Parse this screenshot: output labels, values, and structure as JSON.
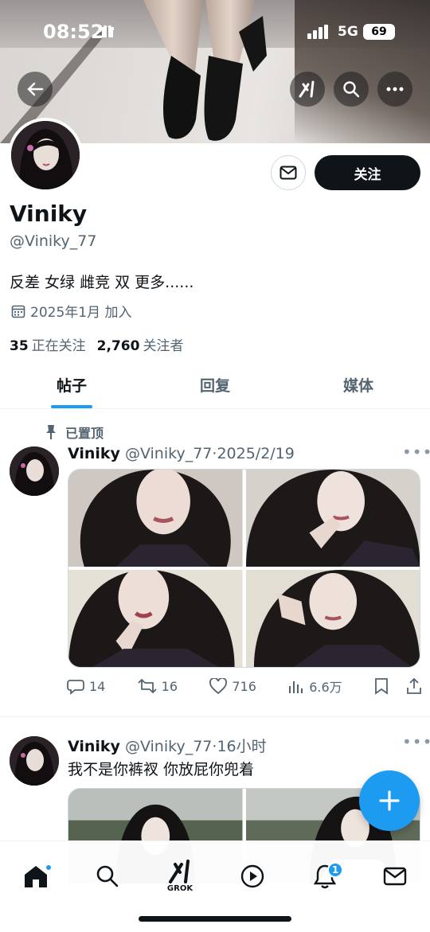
{
  "status_bar": {
    "time": "08:52",
    "network": "5G",
    "battery": "69"
  },
  "profile": {
    "name": "Viniky",
    "handle": "@Viniky_77",
    "bio": "反差 女绿 雌竞 双 更多......",
    "joined": "2025年1月 加入",
    "following_count": "35",
    "following_label": "正在关注",
    "followers_count": "2,760",
    "followers_label": "关注者",
    "follow_button": "关注"
  },
  "tabs": [
    {
      "label": "帖子",
      "active": true
    },
    {
      "label": "回复",
      "active": false
    },
    {
      "label": "媒体",
      "active": false
    }
  ],
  "posts": [
    {
      "pinned_label": "已置顶",
      "name": "Viniky",
      "handle": "@Viniky_77",
      "time": "2025/2/19",
      "replies": "14",
      "reposts": "16",
      "likes": "716",
      "views": "6.6万"
    },
    {
      "name": "Viniky",
      "handle": "@Viniky_77",
      "time": "16小时",
      "text": "我不是你裤衩  你放屁你兜着"
    }
  ],
  "bottom_nav": {
    "grok_label": "GROK",
    "notifications_badge": "1"
  },
  "colors": {
    "accent": "#1d9bf0",
    "text": "#0f1419",
    "secondary": "#536471"
  }
}
